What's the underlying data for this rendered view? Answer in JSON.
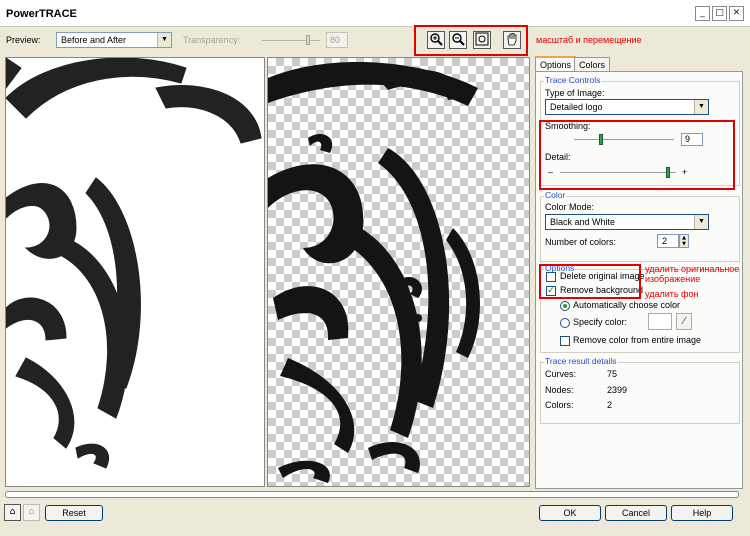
{
  "window": {
    "title": "PowerTRACE",
    "minimize": "_",
    "maximize": "□",
    "close": "✕"
  },
  "toolbar": {
    "preview_label": "Preview:",
    "preview_value": "Before and After",
    "transparency_label": "Transparency:",
    "transparency_value": "80",
    "zoom_in_icon": "zoom-in-icon",
    "zoom_out_icon": "zoom-out-icon",
    "fit_icon": "fit-to-window-icon",
    "pan_icon": "hand-pan-icon"
  },
  "annotations": {
    "zoom_pan": "масштаб и перемещение",
    "delete_original": "удалить оригинальное",
    "delete_original_2": "изображение",
    "remove_bg": "удалить фон"
  },
  "tabs": [
    {
      "label": "Options",
      "active": true
    },
    {
      "label": "Colors",
      "active": false
    }
  ],
  "trace_controls": {
    "group_label": "Trace Controls",
    "type_label": "Type of Image:",
    "type_value": "Detailed logo",
    "smoothing_label": "Smoothing:",
    "smoothing_value": "9",
    "detail_label": "Detail:",
    "detail_minus": "–",
    "detail_plus": "+"
  },
  "color": {
    "group_label": "Color",
    "mode_label": "Color Mode:",
    "mode_value": "Black and White",
    "count_label": "Number of colors:",
    "count_value": "2"
  },
  "options": {
    "group_label": "Options",
    "delete_original": "Delete original image",
    "remove_background": "Remove background",
    "auto_color": "Automatically choose color",
    "specify_color": "Specify color:",
    "remove_entire": "Remove color from entire image"
  },
  "results": {
    "group_label": "Trace result details",
    "curves_label": "Curves:",
    "curves_value": "75",
    "nodes_label": "Nodes:",
    "nodes_value": "2399",
    "colors_label": "Colors:",
    "colors_value": "2"
  },
  "buttons": {
    "reset": "Reset",
    "ok": "OK",
    "cancel": "Cancel",
    "help": "Help"
  },
  "colors": {
    "accent_red": "#e30000",
    "group_blue": "#1f4fd0",
    "slider_green": "#2ca24d"
  }
}
